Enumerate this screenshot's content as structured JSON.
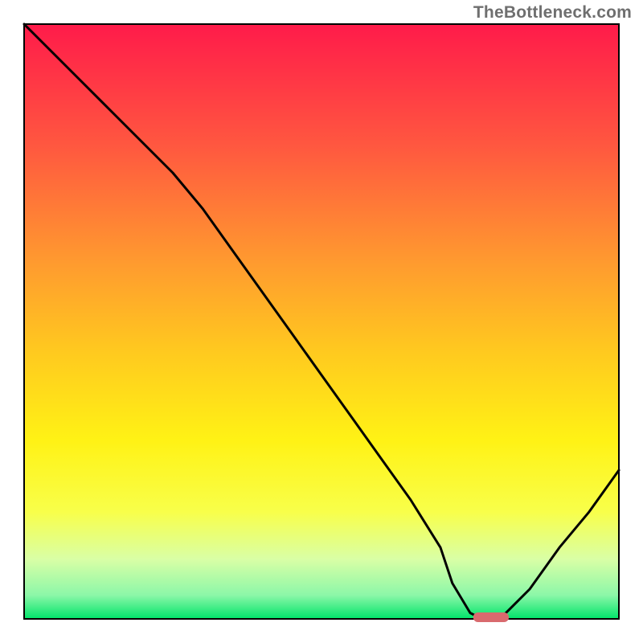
{
  "attribution": "TheBottleneck.com",
  "chart_data": {
    "type": "line",
    "title": "",
    "xlabel": "",
    "ylabel": "",
    "xlim": [
      0,
      100
    ],
    "ylim": [
      0,
      100
    ],
    "grid": false,
    "legend": false,
    "series": [
      {
        "name": "bottleneck-curve",
        "x": [
          0,
          5,
          10,
          15,
          20,
          25,
          30,
          35,
          40,
          45,
          50,
          55,
          60,
          65,
          70,
          72,
          75,
          77,
          80,
          85,
          90,
          95,
          100
        ],
        "y": [
          100,
          95,
          90,
          85,
          80,
          75,
          69,
          62,
          55,
          48,
          41,
          34,
          27,
          20,
          12,
          6,
          1,
          0,
          0,
          5,
          12,
          18,
          25
        ]
      }
    ],
    "marker": {
      "name": "optimal-band",
      "x_center": 78.5,
      "y": 0,
      "width_x": 6
    },
    "gradient_stops": [
      {
        "offset": 0.0,
        "color": "#ff1b4a"
      },
      {
        "offset": 0.2,
        "color": "#ff5640"
      },
      {
        "offset": 0.4,
        "color": "#ff9a2f"
      },
      {
        "offset": 0.55,
        "color": "#ffc91f"
      },
      {
        "offset": 0.7,
        "color": "#fff215"
      },
      {
        "offset": 0.82,
        "color": "#f8ff4a"
      },
      {
        "offset": 0.9,
        "color": "#d9ffa6"
      },
      {
        "offset": 0.96,
        "color": "#8cf7a8"
      },
      {
        "offset": 1.0,
        "color": "#00e46a"
      }
    ]
  }
}
